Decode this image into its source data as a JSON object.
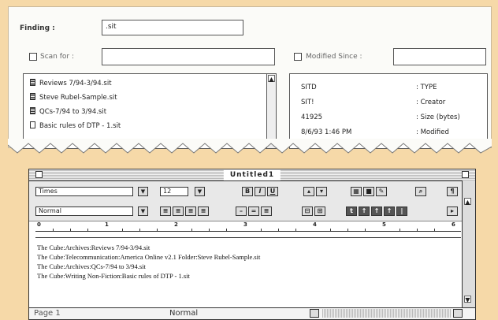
{
  "finder": {
    "finding_label": "Finding :",
    "finding_value": ".sit",
    "scan_for_label": "Scan for :",
    "scan_for_value": "",
    "modified_since_label": "Modified Since :",
    "modified_since_value": "",
    "files": [
      "Reviews 7/94-3/94.sit",
      "Steve Rubel-Sample.sit",
      "QCs-7/94 to 3/94.sit",
      "Basic rules of DTP - 1.sit"
    ],
    "info": [
      {
        "value": "SITD",
        "key": ": TYPE"
      },
      {
        "value": "SIT!",
        "key": ": Creator"
      },
      {
        "value": "41925",
        "key": ": Size (bytes)"
      },
      {
        "value": "8/6/93  1:46 PM",
        "key": ": Modified"
      }
    ]
  },
  "word": {
    "title": "Untitled1",
    "font": "Times",
    "size": "12",
    "style": "Normal",
    "style_buttons": [
      "B",
      "I",
      "U"
    ],
    "ruler_numbers": [
      "0",
      "1",
      "2",
      "3",
      "4",
      "5",
      "6"
    ],
    "lines": [
      "The Cube:Archives:Reviews 7/94-3/94.sit",
      "The Cube:Telecommunication:America Online v2.1 Folder:Steve Rubel-Sample.sit",
      "The Cube:Archives:QCs-7/94 to 3/94.sit",
      "The Cube:Writing Non-Fiction:Basic rules of DTP - 1.sit"
    ],
    "status_page": "Page 1",
    "status_style": "Normal"
  },
  "icons": [
    "document-icon",
    "scroll-up-arrow-icon",
    "scroll-down-arrow-icon",
    "close-box-icon",
    "zoom-box-icon",
    "dropdown-arrow-icon"
  ]
}
